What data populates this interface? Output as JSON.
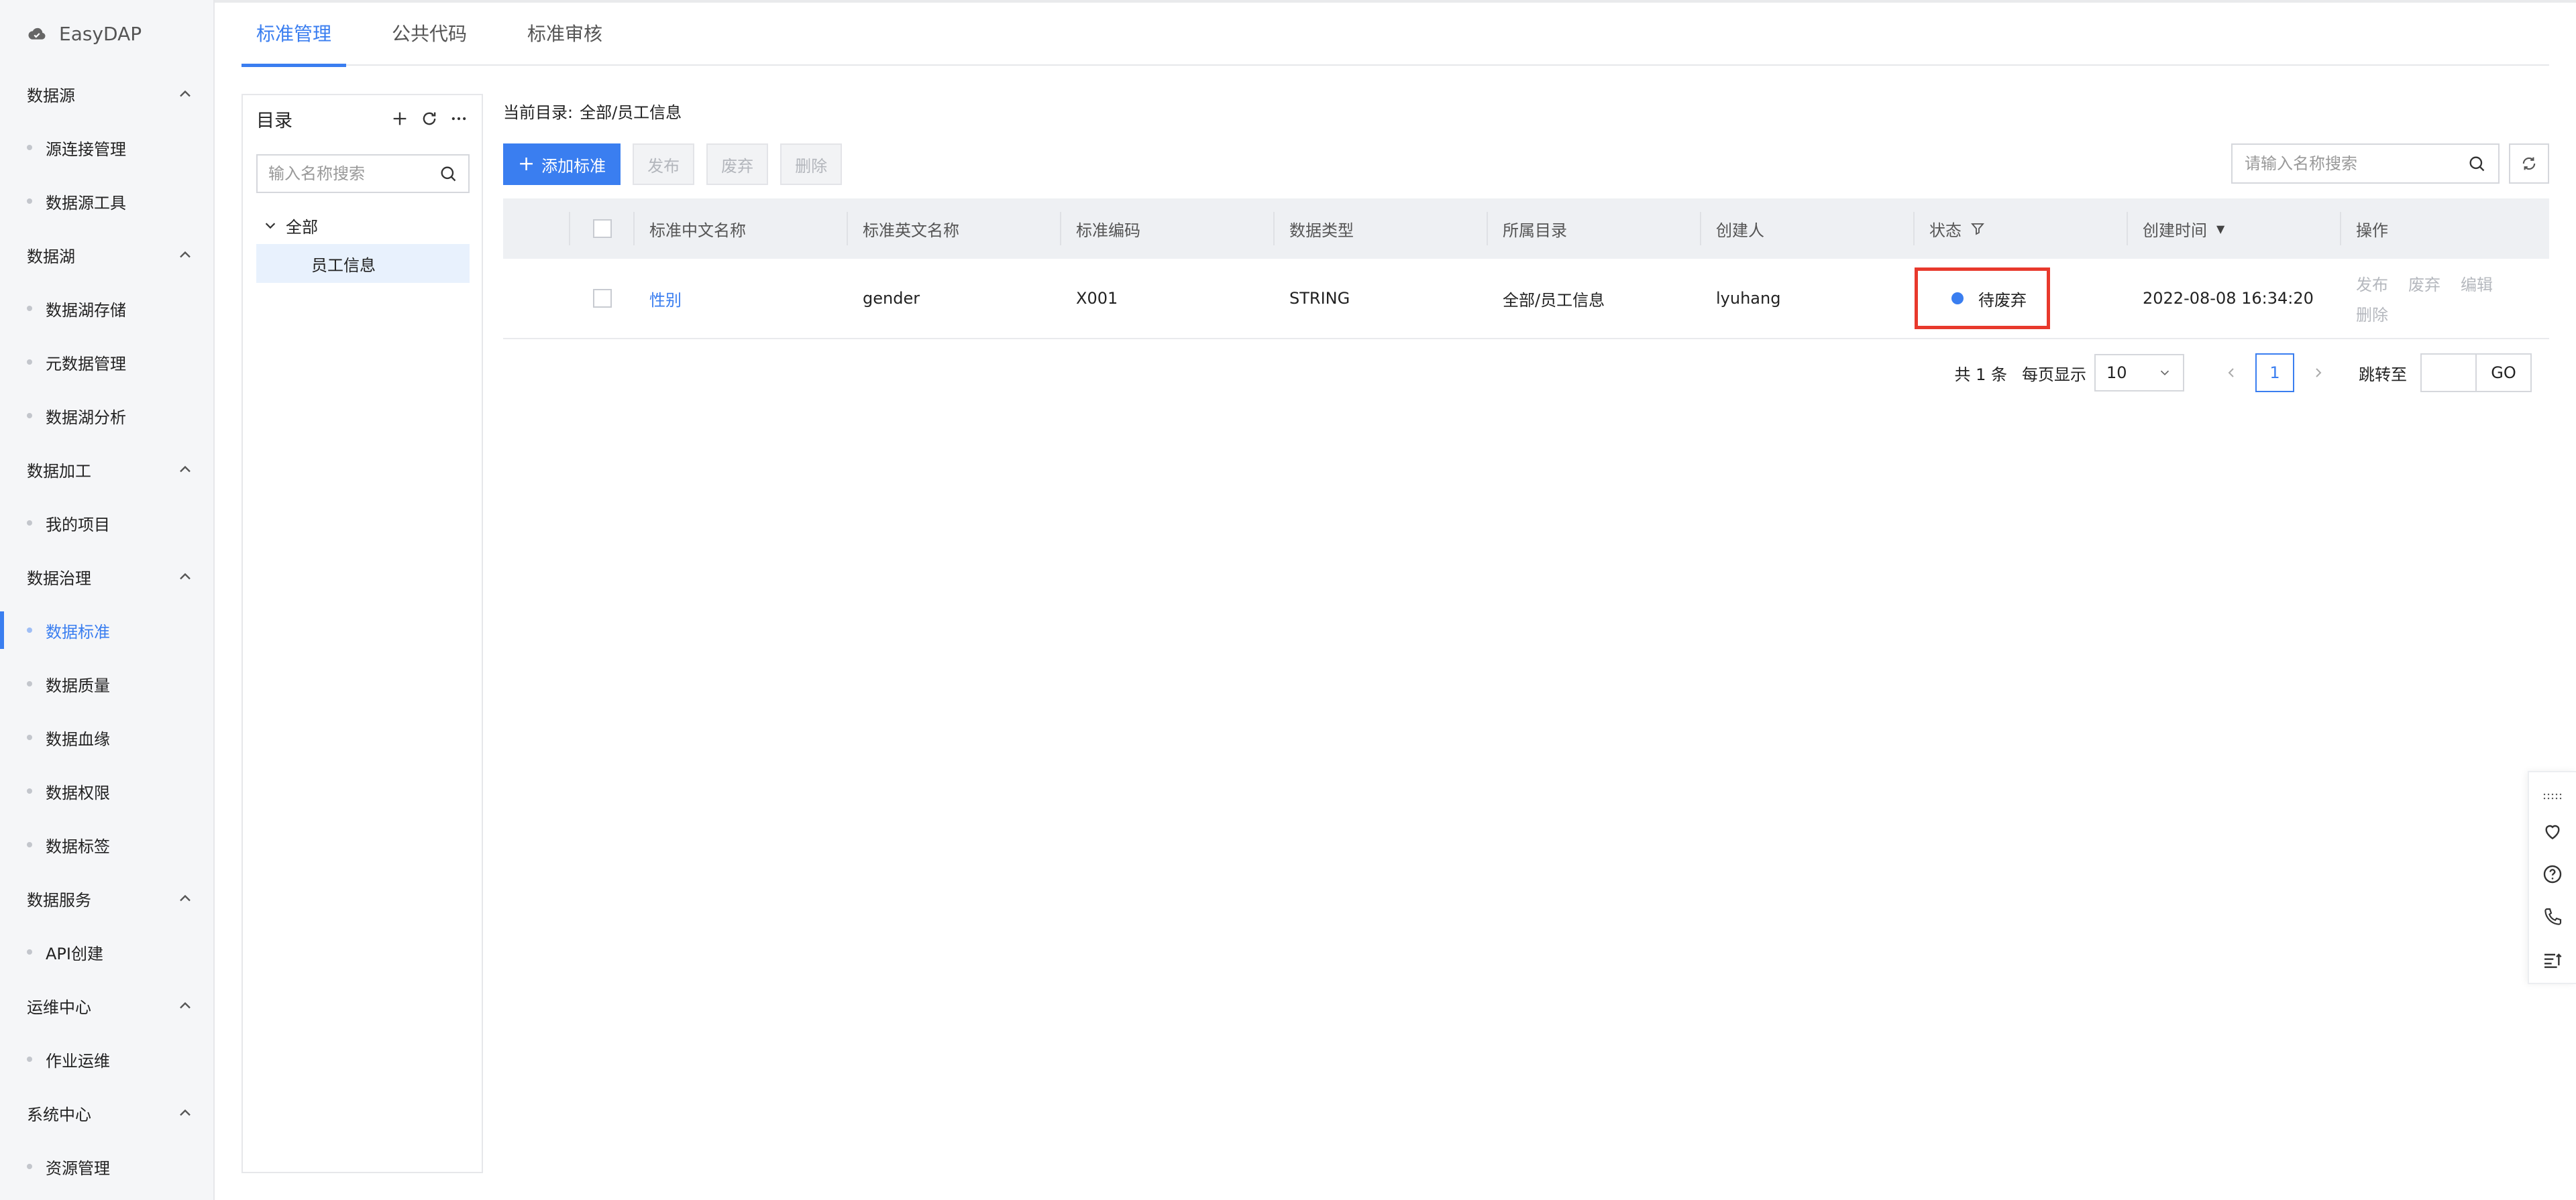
{
  "brand": {
    "name": "EasyDAP"
  },
  "sidebar": {
    "groups": [
      {
        "title": "数据源",
        "items": [
          "源连接管理",
          "数据源工具"
        ]
      },
      {
        "title": "数据湖",
        "items": [
          "数据湖存储",
          "元数据管理",
          "数据湖分析"
        ]
      },
      {
        "title": "数据加工",
        "items": [
          "我的项目"
        ]
      },
      {
        "title": "数据治理",
        "items": [
          "数据标准",
          "数据质量",
          "数据血缘",
          "数据权限",
          "数据标签"
        ]
      },
      {
        "title": "数据服务",
        "items": [
          "API创建"
        ]
      },
      {
        "title": "运维中心",
        "items": [
          "作业运维"
        ]
      },
      {
        "title": "系统中心",
        "items": [
          "资源管理"
        ]
      }
    ],
    "active_item": "数据标准"
  },
  "tabs": {
    "items": [
      "标准管理",
      "公共代码",
      "标准审核"
    ],
    "active": "标准管理"
  },
  "directory": {
    "title": "目录",
    "search_placeholder": "输入名称搜索",
    "tree_root": "全部",
    "tree_child": "员工信息"
  },
  "breadcrumb": {
    "label": "当前目录:",
    "path": "全部/员工信息"
  },
  "toolbar": {
    "add_label": "添加标准",
    "publish_label": "发布",
    "discard_label": "废弃",
    "delete_label": "删除",
    "search_placeholder": "请输入名称搜索"
  },
  "table": {
    "columns": [
      "标准中文名称",
      "标准英文名称",
      "标准编码",
      "数据类型",
      "所属目录",
      "创建人",
      "状态",
      "创建时间",
      "操作"
    ],
    "rows": [
      {
        "cn_name": "性别",
        "en_name": "gender",
        "code": "X001",
        "data_type": "STRING",
        "directory": "全部/员工信息",
        "creator": "lyuhang",
        "status": "待废弃",
        "created_at": "2022-08-08 16:34:20",
        "actions": [
          "发布",
          "废弃",
          "编辑",
          "删除"
        ]
      }
    ]
  },
  "pagination": {
    "total_text": "共 1 条",
    "page_size_label": "每页显示",
    "page_size": "10",
    "current_page": "1",
    "jump_label": "跳转至",
    "go_label": "GO"
  },
  "colors": {
    "accent": "#3a7ef0",
    "highlight_border": "#e8392c",
    "sidebar_bg": "#f5f6f8"
  }
}
